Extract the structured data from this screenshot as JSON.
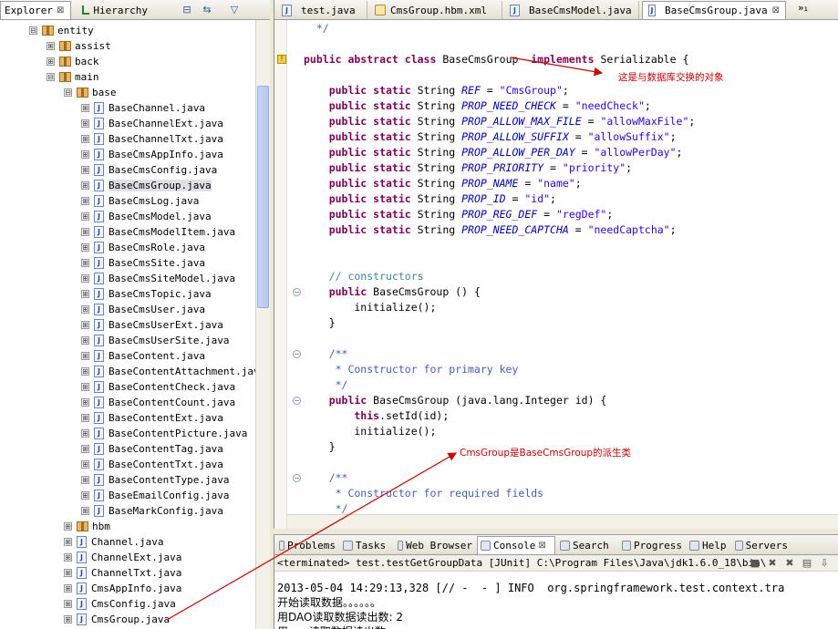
{
  "left_panel": {
    "tabs": [
      {
        "label": "Explorer",
        "close": "⊠"
      },
      {
        "label": "Hierarchy"
      }
    ],
    "toolbar": [
      {
        "name": "collapse-all-icon",
        "glyph": "⊟"
      },
      {
        "name": "link-editor-icon",
        "glyph": "⇆"
      },
      {
        "name": "view-menu-icon",
        "glyph": "▽"
      }
    ],
    "tree": [
      {
        "label": "entity",
        "depth": 0,
        "expander": "⊟",
        "icon": "package"
      },
      {
        "label": "assist",
        "depth": 1,
        "expander": "⊞",
        "icon": "package"
      },
      {
        "label": "back",
        "depth": 1,
        "expander": "⊞",
        "icon": "package"
      },
      {
        "label": "main",
        "depth": 1,
        "expander": "⊟",
        "icon": "package"
      },
      {
        "label": "base",
        "depth": 2,
        "expander": "⊟",
        "icon": "package"
      },
      {
        "label": "BaseChannel.java",
        "depth": 3,
        "expander": "⊞",
        "icon": "java"
      },
      {
        "label": "BaseChannelExt.java",
        "depth": 3,
        "expander": "⊞",
        "icon": "java"
      },
      {
        "label": "BaseChannelTxt.java",
        "depth": 3,
        "expander": "⊞",
        "icon": "java"
      },
      {
        "label": "BaseCmsAppInfo.java",
        "depth": 3,
        "expander": "⊞",
        "icon": "java"
      },
      {
        "label": "BaseCmsConfig.java",
        "depth": 3,
        "expander": "⊞",
        "icon": "java"
      },
      {
        "label": "BaseCmsGroup.java",
        "depth": 3,
        "expander": "⊞",
        "icon": "java",
        "selected": true
      },
      {
        "label": "BaseCmsLog.java",
        "depth": 3,
        "expander": "⊞",
        "icon": "java"
      },
      {
        "label": "BaseCmsModel.java",
        "depth": 3,
        "expander": "⊞",
        "icon": "java"
      },
      {
        "label": "BaseCmsModelItem.java",
        "depth": 3,
        "expander": "⊞",
        "icon": "java"
      },
      {
        "label": "BaseCmsRole.java",
        "depth": 3,
        "expander": "⊞",
        "icon": "java"
      },
      {
        "label": "BaseCmsSite.java",
        "depth": 3,
        "expander": "⊞",
        "icon": "java"
      },
      {
        "label": "BaseCmsSiteModel.java",
        "depth": 3,
        "expander": "⊞",
        "icon": "java"
      },
      {
        "label": "BaseCmsTopic.java",
        "depth": 3,
        "expander": "⊞",
        "icon": "java"
      },
      {
        "label": "BaseCmsUser.java",
        "depth": 3,
        "expander": "⊞",
        "icon": "java"
      },
      {
        "label": "BaseCmsUserExt.java",
        "depth": 3,
        "expander": "⊞",
        "icon": "java"
      },
      {
        "label": "BaseCmsUserSite.java",
        "depth": 3,
        "expander": "⊞",
        "icon": "java"
      },
      {
        "label": "BaseContent.java",
        "depth": 3,
        "expander": "⊞",
        "icon": "java"
      },
      {
        "label": "BaseContentAttachment.java",
        "depth": 3,
        "expander": "⊞",
        "icon": "java"
      },
      {
        "label": "BaseContentCheck.java",
        "depth": 3,
        "expander": "⊞",
        "icon": "java"
      },
      {
        "label": "BaseContentCount.java",
        "depth": 3,
        "expander": "⊞",
        "icon": "java"
      },
      {
        "label": "BaseContentExt.java",
        "depth": 3,
        "expander": "⊞",
        "icon": "java"
      },
      {
        "label": "BaseContentPicture.java",
        "depth": 3,
        "expander": "⊞",
        "icon": "java"
      },
      {
        "label": "BaseContentTag.java",
        "depth": 3,
        "expander": "⊞",
        "icon": "java"
      },
      {
        "label": "BaseContentTxt.java",
        "depth": 3,
        "expander": "⊞",
        "icon": "java"
      },
      {
        "label": "BaseContentType.java",
        "depth": 3,
        "expander": "⊞",
        "icon": "java"
      },
      {
        "label": "BaseEmailConfig.java",
        "depth": 3,
        "expander": "⊞",
        "icon": "java"
      },
      {
        "label": "BaseMarkConfig.java",
        "depth": 3,
        "expander": "⊞",
        "icon": "java"
      },
      {
        "label": "hbm",
        "depth": 2,
        "expander": "⊞",
        "icon": "package"
      },
      {
        "label": "Channel.java",
        "depth": 2,
        "expander": "⊞",
        "icon": "java"
      },
      {
        "label": "ChannelExt.java",
        "depth": 2,
        "expander": "⊞",
        "icon": "java"
      },
      {
        "label": "ChannelTxt.java",
        "depth": 2,
        "expander": "⊞",
        "icon": "java"
      },
      {
        "label": "CmsAppInfo.java",
        "depth": 2,
        "expander": "⊞",
        "icon": "java"
      },
      {
        "label": "CmsConfig.java",
        "depth": 2,
        "expander": "⊞",
        "icon": "java"
      },
      {
        "label": "CmsGroup.java",
        "depth": 2,
        "expander": "⊞",
        "icon": "java"
      }
    ]
  },
  "editor": {
    "tabs": [
      {
        "label": "test.java",
        "icon": "java"
      },
      {
        "label": "CmsGroup.hbm.xml",
        "icon": "xml"
      },
      {
        "label": "BaseCmsModel.java",
        "icon": "java"
      },
      {
        "label": "BaseCmsGroup.java",
        "icon": "java",
        "active": true,
        "close": "⊠"
      }
    ],
    "overflow_label": "»₁",
    "code_lines": [
      {
        "line": 0,
        "segments": [
          {
            "t": "  */",
            "c": "cm2"
          }
        ]
      },
      {
        "line": 2,
        "segments": [
          {
            "t": "public abstract class ",
            "c": "kw"
          },
          {
            "t": "BaseCmsGroup",
            "c": ""
          },
          {
            "t": "  implements ",
            "c": "kw"
          },
          {
            "t": "Serializable {",
            "c": ""
          }
        ]
      },
      {
        "line": 4,
        "segments": [
          {
            "t": "    public static ",
            "c": "kw"
          },
          {
            "t": "String ",
            "c": ""
          },
          {
            "t": "REF",
            "c": "fi"
          },
          {
            "t": " = ",
            "c": ""
          },
          {
            "t": "\"CmsGroup\"",
            "c": "st"
          },
          {
            "t": ";",
            "c": ""
          }
        ]
      },
      {
        "line": 5,
        "segments": [
          {
            "t": "    public static ",
            "c": "kw"
          },
          {
            "t": "String ",
            "c": ""
          },
          {
            "t": "PROP_NEED_CHECK",
            "c": "fi"
          },
          {
            "t": " = ",
            "c": ""
          },
          {
            "t": "\"needCheck\"",
            "c": "st"
          },
          {
            "t": ";",
            "c": ""
          }
        ]
      },
      {
        "line": 6,
        "segments": [
          {
            "t": "    public static ",
            "c": "kw"
          },
          {
            "t": "String ",
            "c": ""
          },
          {
            "t": "PROP_ALLOW_MAX_FILE",
            "c": "fi"
          },
          {
            "t": " = ",
            "c": ""
          },
          {
            "t": "\"allowMaxFile\"",
            "c": "st"
          },
          {
            "t": ";",
            "c": ""
          }
        ]
      },
      {
        "line": 7,
        "segments": [
          {
            "t": "    public static ",
            "c": "kw"
          },
          {
            "t": "String ",
            "c": ""
          },
          {
            "t": "PROP_ALLOW_SUFFIX",
            "c": "fi"
          },
          {
            "t": " = ",
            "c": ""
          },
          {
            "t": "\"allowSuffix\"",
            "c": "st"
          },
          {
            "t": ";",
            "c": ""
          }
        ]
      },
      {
        "line": 8,
        "segments": [
          {
            "t": "    public static ",
            "c": "kw"
          },
          {
            "t": "String ",
            "c": ""
          },
          {
            "t": "PROP_ALLOW_PER_DAY",
            "c": "fi"
          },
          {
            "t": " = ",
            "c": ""
          },
          {
            "t": "\"allowPerDay\"",
            "c": "st"
          },
          {
            "t": ";",
            "c": ""
          }
        ]
      },
      {
        "line": 9,
        "segments": [
          {
            "t": "    public static ",
            "c": "kw"
          },
          {
            "t": "String ",
            "c": ""
          },
          {
            "t": "PROP_PRIORITY",
            "c": "fi"
          },
          {
            "t": " = ",
            "c": ""
          },
          {
            "t": "\"priority\"",
            "c": "st"
          },
          {
            "t": ";",
            "c": ""
          }
        ]
      },
      {
        "line": 10,
        "segments": [
          {
            "t": "    public static ",
            "c": "kw"
          },
          {
            "t": "String ",
            "c": ""
          },
          {
            "t": "PROP_NAME",
            "c": "fi"
          },
          {
            "t": " = ",
            "c": ""
          },
          {
            "t": "\"name\"",
            "c": "st"
          },
          {
            "t": ";",
            "c": ""
          }
        ]
      },
      {
        "line": 11,
        "segments": [
          {
            "t": "    public static ",
            "c": "kw"
          },
          {
            "t": "String ",
            "c": ""
          },
          {
            "t": "PROP_ID",
            "c": "fi"
          },
          {
            "t": " = ",
            "c": ""
          },
          {
            "t": "\"id\"",
            "c": "st"
          },
          {
            "t": ";",
            "c": ""
          }
        ]
      },
      {
        "line": 12,
        "segments": [
          {
            "t": "    public static ",
            "c": "kw"
          },
          {
            "t": "String ",
            "c": ""
          },
          {
            "t": "PROP_REG_DEF",
            "c": "fi"
          },
          {
            "t": " = ",
            "c": ""
          },
          {
            "t": "\"regDef\"",
            "c": "st"
          },
          {
            "t": ";",
            "c": ""
          }
        ]
      },
      {
        "line": 13,
        "segments": [
          {
            "t": "    public static ",
            "c": "kw"
          },
          {
            "t": "String ",
            "c": ""
          },
          {
            "t": "PROP_NEED_CAPTCHA",
            "c": "fi"
          },
          {
            "t": " = ",
            "c": ""
          },
          {
            "t": "\"needCaptcha\"",
            "c": "st"
          },
          {
            "t": ";",
            "c": ""
          }
        ]
      },
      {
        "line": 16,
        "segments": [
          {
            "t": "    // constructors",
            "c": "cm"
          }
        ]
      },
      {
        "line": 17,
        "segments": [
          {
            "t": "    public ",
            "c": "kw"
          },
          {
            "t": "BaseCmsGroup () {",
            "c": ""
          }
        ]
      },
      {
        "line": 18,
        "segments": [
          {
            "t": "        initialize();",
            "c": ""
          }
        ]
      },
      {
        "line": 19,
        "segments": [
          {
            "t": "    }",
            "c": ""
          }
        ]
      },
      {
        "line": 21,
        "segments": [
          {
            "t": "    /**",
            "c": "cm2"
          }
        ]
      },
      {
        "line": 22,
        "segments": [
          {
            "t": "     * Constructor for primary key",
            "c": "cm2"
          }
        ]
      },
      {
        "line": 23,
        "segments": [
          {
            "t": "     */",
            "c": "cm2"
          }
        ]
      },
      {
        "line": 24,
        "segments": [
          {
            "t": "    public ",
            "c": "kw"
          },
          {
            "t": "BaseCmsGroup (java.lang.Integer id) {",
            "c": ""
          }
        ]
      },
      {
        "line": 25,
        "segments": [
          {
            "t": "        this",
            "c": "kw"
          },
          {
            "t": ".setId(id);",
            "c": ""
          }
        ]
      },
      {
        "line": 26,
        "segments": [
          {
            "t": "        initialize();",
            "c": ""
          }
        ]
      },
      {
        "line": 27,
        "segments": [
          {
            "t": "    }",
            "c": ""
          }
        ]
      },
      {
        "line": 29,
        "segments": [
          {
            "t": "    /**",
            "c": "cm2"
          }
        ]
      },
      {
        "line": 30,
        "segments": [
          {
            "t": "     * Constructor for required fields",
            "c": "cm2"
          }
        ]
      },
      {
        "line": 31,
        "segments": [
          {
            "t": "     */",
            "c": "cm2"
          }
        ]
      }
    ],
    "fold_lines": [
      17,
      21,
      24,
      29
    ],
    "warning_line": 2,
    "annotations": [
      {
        "text": "这是与数据库交换的对象"
      },
      {
        "text": "CmsGroup是BaseCmsGroup的派生类"
      }
    ]
  },
  "bottom_panel": {
    "tabs": [
      {
        "label": "Problems"
      },
      {
        "label": "Tasks"
      },
      {
        "label": "Web Browser"
      },
      {
        "label": "Console",
        "active": true,
        "close": "⊠"
      },
      {
        "label": "Search"
      },
      {
        "label": "Progress"
      },
      {
        "label": "Help"
      },
      {
        "label": "Servers"
      }
    ],
    "console_title": "<terminated> test.testGetGroupData [JUnit] C:\\Program Files\\Java\\jdk1.6.0_18\\bin\\",
    "console_tools": [
      {
        "name": "terminate-icon",
        "glyph": "■"
      },
      {
        "name": "remove-launch-icon",
        "glyph": "✖"
      },
      {
        "name": "remove-all-icon",
        "glyph": "✖"
      },
      {
        "name": "clear-console-icon",
        "glyph": "▤"
      },
      {
        "name": "scroll-lock-icon",
        "glyph": "⇩"
      }
    ],
    "console_lines": [
      {
        "text": "2013-05-04 14:29:13,328 [// -  - ] INFO  org.springframework.test.context.tra",
        "cn": false
      },
      {
        "text": "开始读取数据。。。。。。",
        "cn": true
      },
      {
        "text": "用DAO读取数据读出数: 2",
        "cn": true
      },
      {
        "text": "用......读取数据读出数",
        "cn": true
      }
    ]
  },
  "colors": {
    "keyword": "#7f0055",
    "string": "#2a00ff",
    "comment": "#3f7f9f",
    "javadoc": "#3f5fbf",
    "field": "#0000c0",
    "annotation": "#cc0000"
  }
}
